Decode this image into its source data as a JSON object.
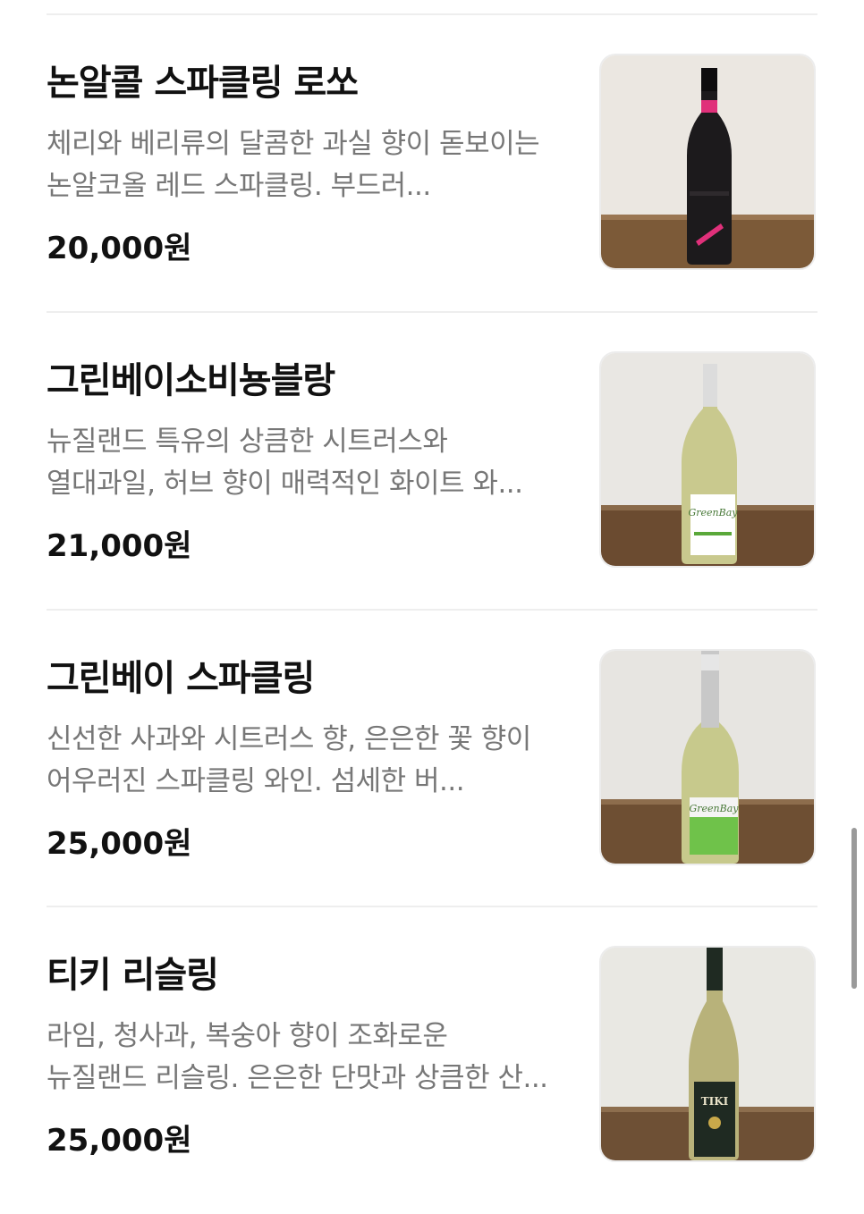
{
  "menu": {
    "items": [
      {
        "name": "논알콜 스파클링 로쏘",
        "description": "체리와 베리류의 달콤한 과실 향이 돋보이는 논알코올 레드 스파클링. 부드러...",
        "price": "20,000원",
        "photo_icon": "wine-bottle-icon",
        "bottle_color": "#1c1a1c",
        "label_color": "#e0307a"
      },
      {
        "name": "그린베이소비뇽블랑",
        "description": "뉴질랜드 특유의 상큼한 시트러스와 열대과일, 허브 향이 매력적인 화이트 와...",
        "price": "21,000원",
        "photo_icon": "wine-bottle-icon",
        "bottle_color": "#c9c98e",
        "label_color": "#ffffff"
      },
      {
        "name": "그린베이 스파클링",
        "description": "신선한 사과와 시트러스 향, 은은한 꽃 향이 어우러진 스파클링 와인. 섬세한 버...",
        "price": "25,000원",
        "photo_icon": "wine-bottle-icon",
        "bottle_color": "#c7c98c",
        "label_color": "#6fc24a"
      },
      {
        "name": "티키 리슬링",
        "description": "라임, 청사과, 복숭아 향이 조화로운 뉴질랜드 리슬링. 은은한 단맛과 상큼한 산...",
        "price": "25,000원",
        "photo_icon": "wine-bottle-icon",
        "bottle_color": "#b8b27a",
        "label_color": "#1f2a22"
      }
    ]
  }
}
